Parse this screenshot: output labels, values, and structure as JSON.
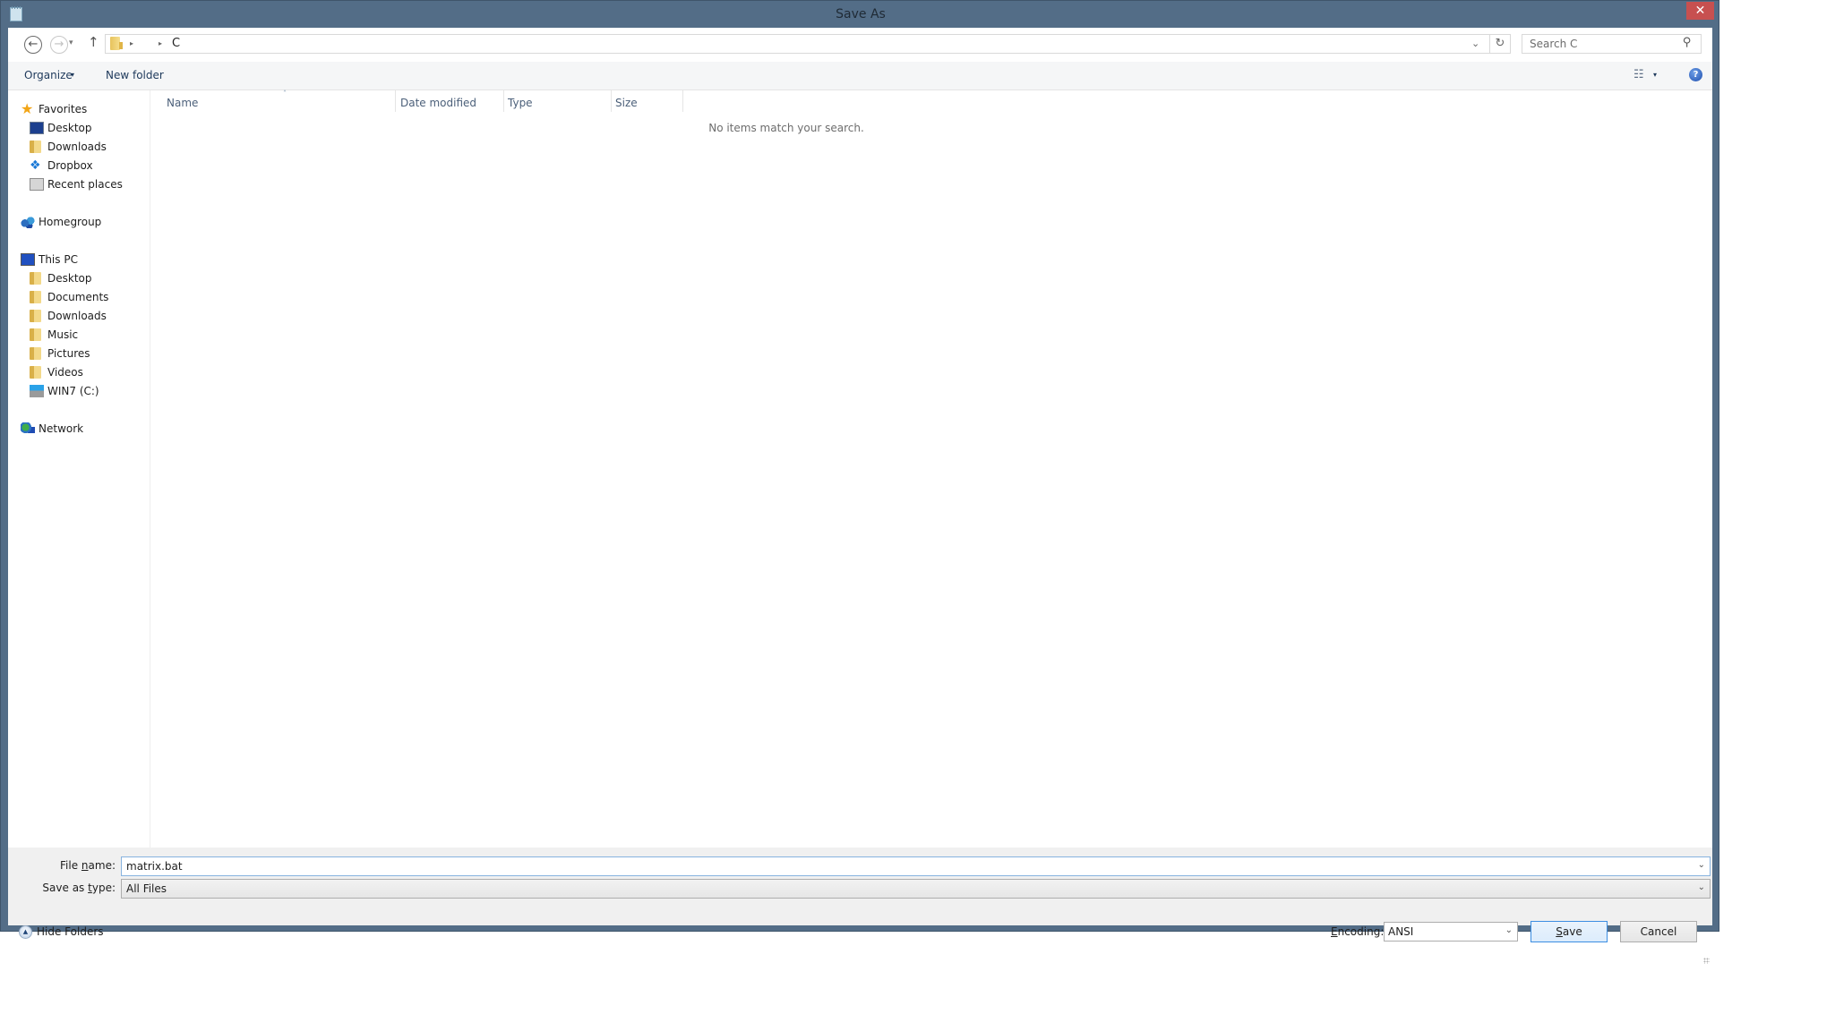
{
  "window": {
    "title": "Save As",
    "app_icon": "notepad-icon",
    "close_glyph": "✕",
    "colors": {
      "frame": "#536d87",
      "close": "#c75050",
      "accent": "#3c8ee2"
    }
  },
  "navigation": {
    "back_glyph": "←",
    "forward_glyph": "→",
    "recent_glyph": "▾",
    "up_glyph": "↑",
    "breadcrumb": {
      "sep": "▸",
      "current": "C"
    },
    "address_dropdown_glyph": "⌄",
    "refresh_glyph": "↻",
    "search": {
      "placeholder": "Search C",
      "icon_glyph": "⚲"
    }
  },
  "toolbar": {
    "organize_label": "Organize",
    "organize_caret": "▾",
    "new_folder_label": "New folder",
    "view_glyph": "☷",
    "view_caret": "▾",
    "help_glyph": "?"
  },
  "sidebar": {
    "groups": [
      {
        "label": "Favorites",
        "icon": "star-icon",
        "items": [
          {
            "label": "Desktop",
            "icon": "desktop-icon"
          },
          {
            "label": "Downloads",
            "icon": "downloads-folder-icon"
          },
          {
            "label": "Dropbox",
            "icon": "dropbox-icon"
          },
          {
            "label": "Recent places",
            "icon": "recent-places-icon"
          }
        ]
      },
      {
        "label": "Homegroup",
        "icon": "homegroup-icon",
        "items": []
      },
      {
        "label": "This PC",
        "icon": "computer-icon",
        "items": [
          {
            "label": "Desktop",
            "icon": "desktop-folder-icon"
          },
          {
            "label": "Documents",
            "icon": "documents-folder-icon"
          },
          {
            "label": "Downloads",
            "icon": "downloads-folder-icon"
          },
          {
            "label": "Music",
            "icon": "music-folder-icon"
          },
          {
            "label": "Pictures",
            "icon": "pictures-folder-icon"
          },
          {
            "label": "Videos",
            "icon": "videos-folder-icon"
          },
          {
            "label": "WIN7 (C:)",
            "icon": "drive-icon"
          }
        ]
      },
      {
        "label": "Network",
        "icon": "network-icon",
        "items": []
      }
    ]
  },
  "file_list": {
    "columns": [
      "Name",
      "Date modified",
      "Type",
      "Size"
    ],
    "sort_glyph": "˄",
    "empty_message": "No items match your search."
  },
  "footer": {
    "file_name_label_pre": "File ",
    "file_name_label_accel": "n",
    "file_name_label_post": "ame:",
    "file_name_value": "matrix.bat",
    "save_type_label_pre": "Save as ",
    "save_type_label_accel": "t",
    "save_type_label_post": "ype:",
    "save_type_value": "All Files",
    "dropdown_glyph": "⌄",
    "hide_folders_label": "Hide Folders",
    "hide_folders_glyph": "▲",
    "encoding_label_accel": "E",
    "encoding_label_post": "ncoding:",
    "encoding_value": "ANSI",
    "save_label_accel": "S",
    "save_label_post": "ave",
    "cancel_label": "Cancel"
  }
}
